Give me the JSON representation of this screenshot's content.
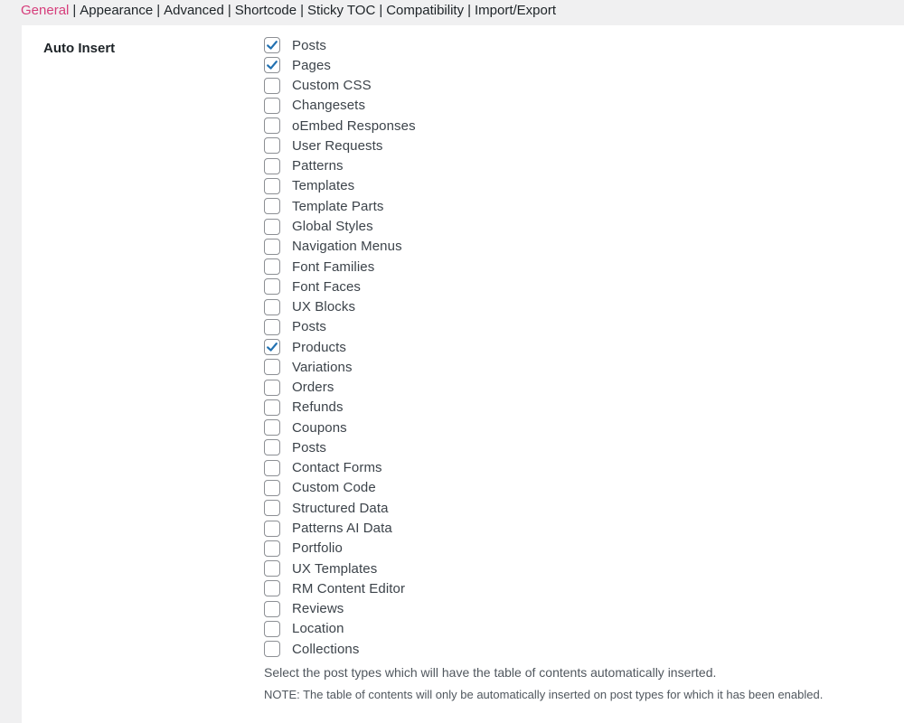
{
  "tabs": [
    {
      "label": "General",
      "active": true
    },
    {
      "label": "Appearance",
      "active": false
    },
    {
      "label": "Advanced",
      "active": false
    },
    {
      "label": "Shortcode",
      "active": false
    },
    {
      "label": "Sticky TOC",
      "active": false
    },
    {
      "label": "Compatibility",
      "active": false
    },
    {
      "label": "Import/Export",
      "active": false
    }
  ],
  "tab_separator": "|",
  "colors": {
    "active_tab": "#d63d7b",
    "checkmark": "#2271b1"
  },
  "auto_insert": {
    "label": "Auto Insert",
    "options": [
      {
        "label": "Posts",
        "checked": true
      },
      {
        "label": "Pages",
        "checked": true
      },
      {
        "label": "Custom CSS",
        "checked": false
      },
      {
        "label": "Changesets",
        "checked": false
      },
      {
        "label": "oEmbed Responses",
        "checked": false
      },
      {
        "label": "User Requests",
        "checked": false
      },
      {
        "label": "Patterns",
        "checked": false
      },
      {
        "label": "Templates",
        "checked": false
      },
      {
        "label": "Template Parts",
        "checked": false
      },
      {
        "label": "Global Styles",
        "checked": false
      },
      {
        "label": "Navigation Menus",
        "checked": false
      },
      {
        "label": "Font Families",
        "checked": false
      },
      {
        "label": "Font Faces",
        "checked": false
      },
      {
        "label": "UX Blocks",
        "checked": false
      },
      {
        "label": "Posts",
        "checked": false
      },
      {
        "label": "Products",
        "checked": true
      },
      {
        "label": "Variations",
        "checked": false
      },
      {
        "label": "Orders",
        "checked": false
      },
      {
        "label": "Refunds",
        "checked": false
      },
      {
        "label": "Coupons",
        "checked": false
      },
      {
        "label": "Posts",
        "checked": false
      },
      {
        "label": "Contact Forms",
        "checked": false
      },
      {
        "label": "Custom Code",
        "checked": false
      },
      {
        "label": "Structured Data",
        "checked": false
      },
      {
        "label": "Patterns AI Data",
        "checked": false
      },
      {
        "label": "Portfolio",
        "checked": false
      },
      {
        "label": "UX Templates",
        "checked": false
      },
      {
        "label": "RM Content Editor",
        "checked": false
      },
      {
        "label": "Reviews",
        "checked": false
      },
      {
        "label": "Location",
        "checked": false
      },
      {
        "label": "Collections",
        "checked": false
      }
    ],
    "description": "Select the post types which will have the table of contents automatically inserted.",
    "note": "NOTE: The table of contents will only be automatically inserted on post types for which it has been enabled."
  }
}
